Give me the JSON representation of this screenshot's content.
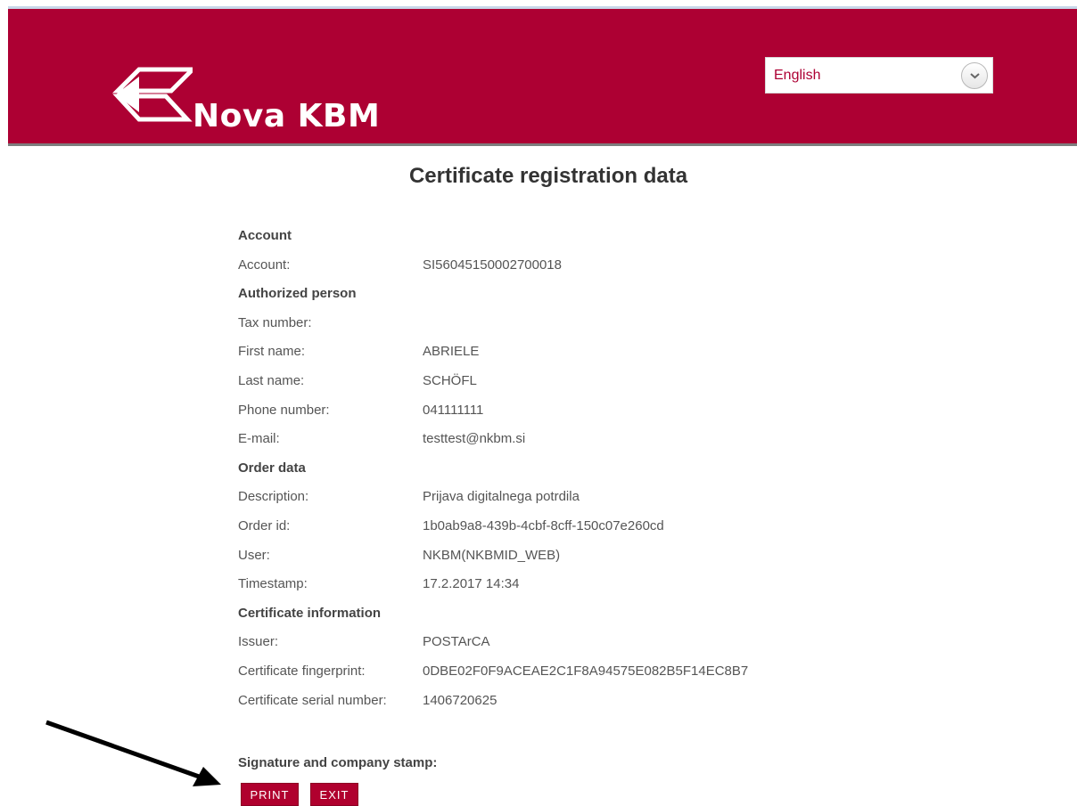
{
  "header": {
    "brand": "Nova KBM",
    "logo_icon": "nkbm-chevron-logo",
    "background_color": "#ad0033"
  },
  "language_select": {
    "selected": "English",
    "icon": "chevron-down-icon"
  },
  "page": {
    "title": "Certificate registration data"
  },
  "sections": {
    "account": {
      "title": "Account",
      "fields": [
        {
          "label": "Account:",
          "value": "SI56045150002700018"
        }
      ]
    },
    "authorized_person": {
      "title": "Authorized person",
      "fields": [
        {
          "label": "Tax number:",
          "value": ""
        },
        {
          "label": "First name:",
          "value": "ABRIELE"
        },
        {
          "label": "Last name:",
          "value": "SCHÖFL"
        },
        {
          "label": "Phone number:",
          "value": "041111111"
        },
        {
          "label": "E-mail:",
          "value": "testtest@nkbm.si"
        }
      ]
    },
    "order_data": {
      "title": "Order data",
      "fields": [
        {
          "label": "Description:",
          "value": "Prijava digitalnega potrdila"
        },
        {
          "label": "Order id:",
          "value": "1b0ab9a8-439b-4cbf-8cff-150c07e260cd"
        },
        {
          "label": "User:",
          "value": "NKBM(NKBMID_WEB)"
        },
        {
          "label": "Timestamp:",
          "value": "17.2.2017 14:34"
        }
      ]
    },
    "certificate_information": {
      "title": "Certificate information",
      "fields": [
        {
          "label": "Issuer:",
          "value": "POSTArCA"
        },
        {
          "label": "Certificate fingerprint:",
          "value": "0DBE02F0F9ACEAE2C1F8A94575E082B5F14EC8B7"
        },
        {
          "label": "Certificate serial number:",
          "value": "1406720625"
        }
      ]
    }
  },
  "signature": {
    "label": "Signature and company stamp:"
  },
  "buttons": {
    "print": "PRINT",
    "exit": "EXIT"
  },
  "annotation": {
    "icon": "arrow-icon"
  }
}
